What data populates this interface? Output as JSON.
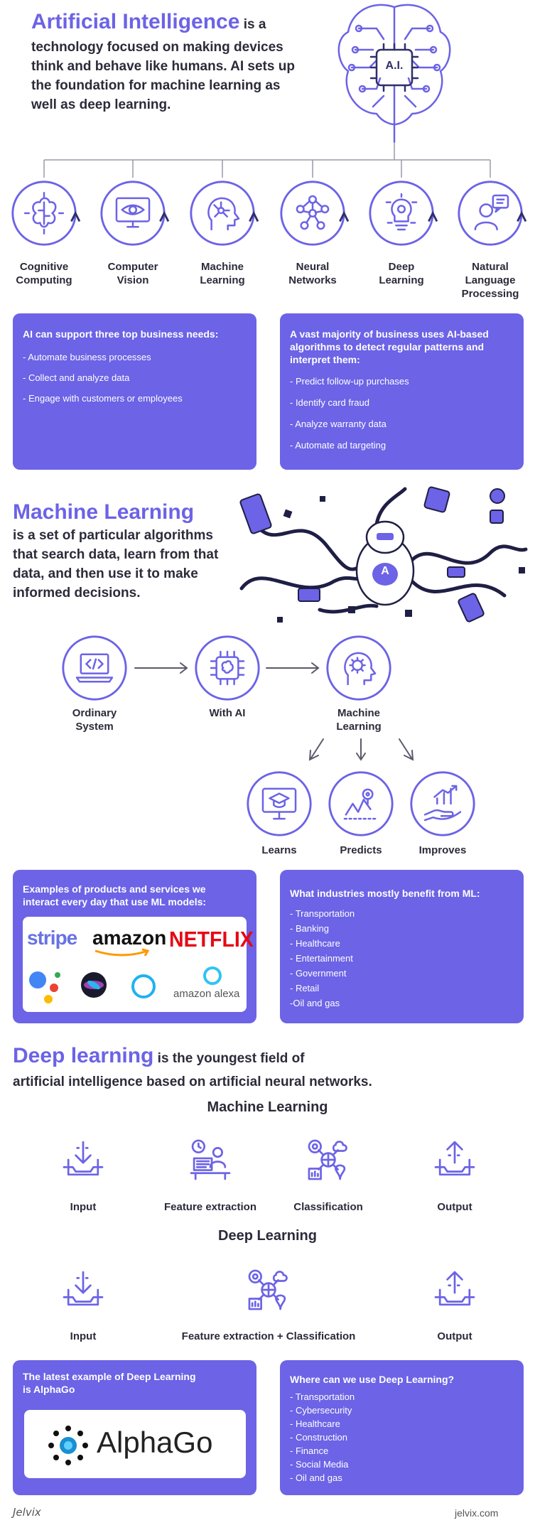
{
  "ai": {
    "title": "Artificial Intelligence",
    "intro_after_title": " is a",
    "intro_lines": [
      "technology focused on making devices",
      "think and behave like humans. AI sets up",
      "the foundation for machine learning as",
      "well as deep learning."
    ],
    "chip_label": "A.I.",
    "fields": [
      {
        "label_lines": [
          "Cognitive",
          "Computing"
        ],
        "icon": "brain-circuit-icon"
      },
      {
        "label_lines": [
          "Computer",
          "Vision"
        ],
        "icon": "monitor-eye-icon"
      },
      {
        "label_lines": [
          "Machine",
          "Learning"
        ],
        "icon": "head-network-icon"
      },
      {
        "label_lines": [
          "Neural",
          "Networks"
        ],
        "icon": "network-nodes-icon"
      },
      {
        "label_lines": [
          "Deep",
          "Learning"
        ],
        "icon": "bulb-gears-icon"
      },
      {
        "label_lines": [
          "Natural",
          "Language",
          "Processing"
        ],
        "icon": "person-speech-icon"
      }
    ],
    "needs_panel": {
      "heading": "AI can support three top business needs:",
      "items": [
        "- Automate business processes",
        "- Collect and analyze data",
        "- Engage with customers or employees"
      ]
    },
    "patterns_panel": {
      "heading_lines": [
        "A vast majority of business uses AI-based",
        "algorithms to detect regular patterns and",
        "interpret them:"
      ],
      "items": [
        "- Predict follow-up purchases",
        "- Identify card fraud",
        "- Analyze warranty data",
        "- Automate ad targeting"
      ]
    }
  },
  "ml": {
    "title": "Machine Learning",
    "desc_lines": [
      "is a set of particular algorithms",
      "that search data, learn from that",
      "data, and then use it to make",
      "informed decisions."
    ],
    "robot_letter": "A",
    "flow": [
      {
        "label_lines": [
          "Ordinary",
          "System"
        ],
        "icon": "laptop-code-icon"
      },
      {
        "label_lines": [
          "With AI"
        ],
        "icon": "chip-brain-icon"
      },
      {
        "label_lines": [
          "Machine",
          "Learning"
        ],
        "icon": "head-gear-icon"
      }
    ],
    "outcomes": [
      {
        "label": "Learns",
        "icon": "monitor-graduation-icon"
      },
      {
        "label": "Predicts",
        "icon": "map-route-icon"
      },
      {
        "label": "Improves",
        "icon": "hand-growth-icon"
      }
    ],
    "products_panel": {
      "heading_lines": [
        "Examples of products and services we",
        "interact every day that use ML models:"
      ],
      "logos": {
        "stripe": "stripe",
        "amazon": "amazon",
        "netflix": "NETFLIX",
        "alexa": "amazon alexa"
      }
    },
    "industries_panel": {
      "heading": "What industries mostly benefit from ML:",
      "items": [
        "- Transportation",
        "- Banking",
        "- Healthcare",
        "- Entertainment",
        "- Government",
        "- Retail",
        "-Oil and gas"
      ]
    }
  },
  "dl": {
    "title": "Deep learning",
    "intro_after_title": " is the youngest field of",
    "intro_line2": "artificial intelligence based on artificial neural networks.",
    "ml_pipeline": {
      "heading": "Machine Learning",
      "steps": [
        "Input",
        "Feature extraction",
        "Classification",
        "Output"
      ]
    },
    "dl_pipeline": {
      "heading": "Deep Learning",
      "steps": [
        "Input",
        "Feature extraction + Classification",
        "Output"
      ]
    },
    "alphago_panel": {
      "heading_lines": [
        "The latest example of Deep Learning",
        "is AlphaGo"
      ],
      "logo_text": "AlphaGo"
    },
    "uses_panel": {
      "heading": "Where can we use Deep Learning?",
      "items": [
        "- Transportation",
        "- Cybersecurity",
        "- Healthcare",
        "- Construction",
        "- Finance",
        "- Social Media",
        "- Oil and gas"
      ]
    }
  },
  "footer": {
    "brand": "Jelvix",
    "site": "jelvix.com"
  },
  "colors": {
    "accent": "#6c63e6",
    "dark": "#2e2f6a",
    "text": "#2b2b3a"
  }
}
